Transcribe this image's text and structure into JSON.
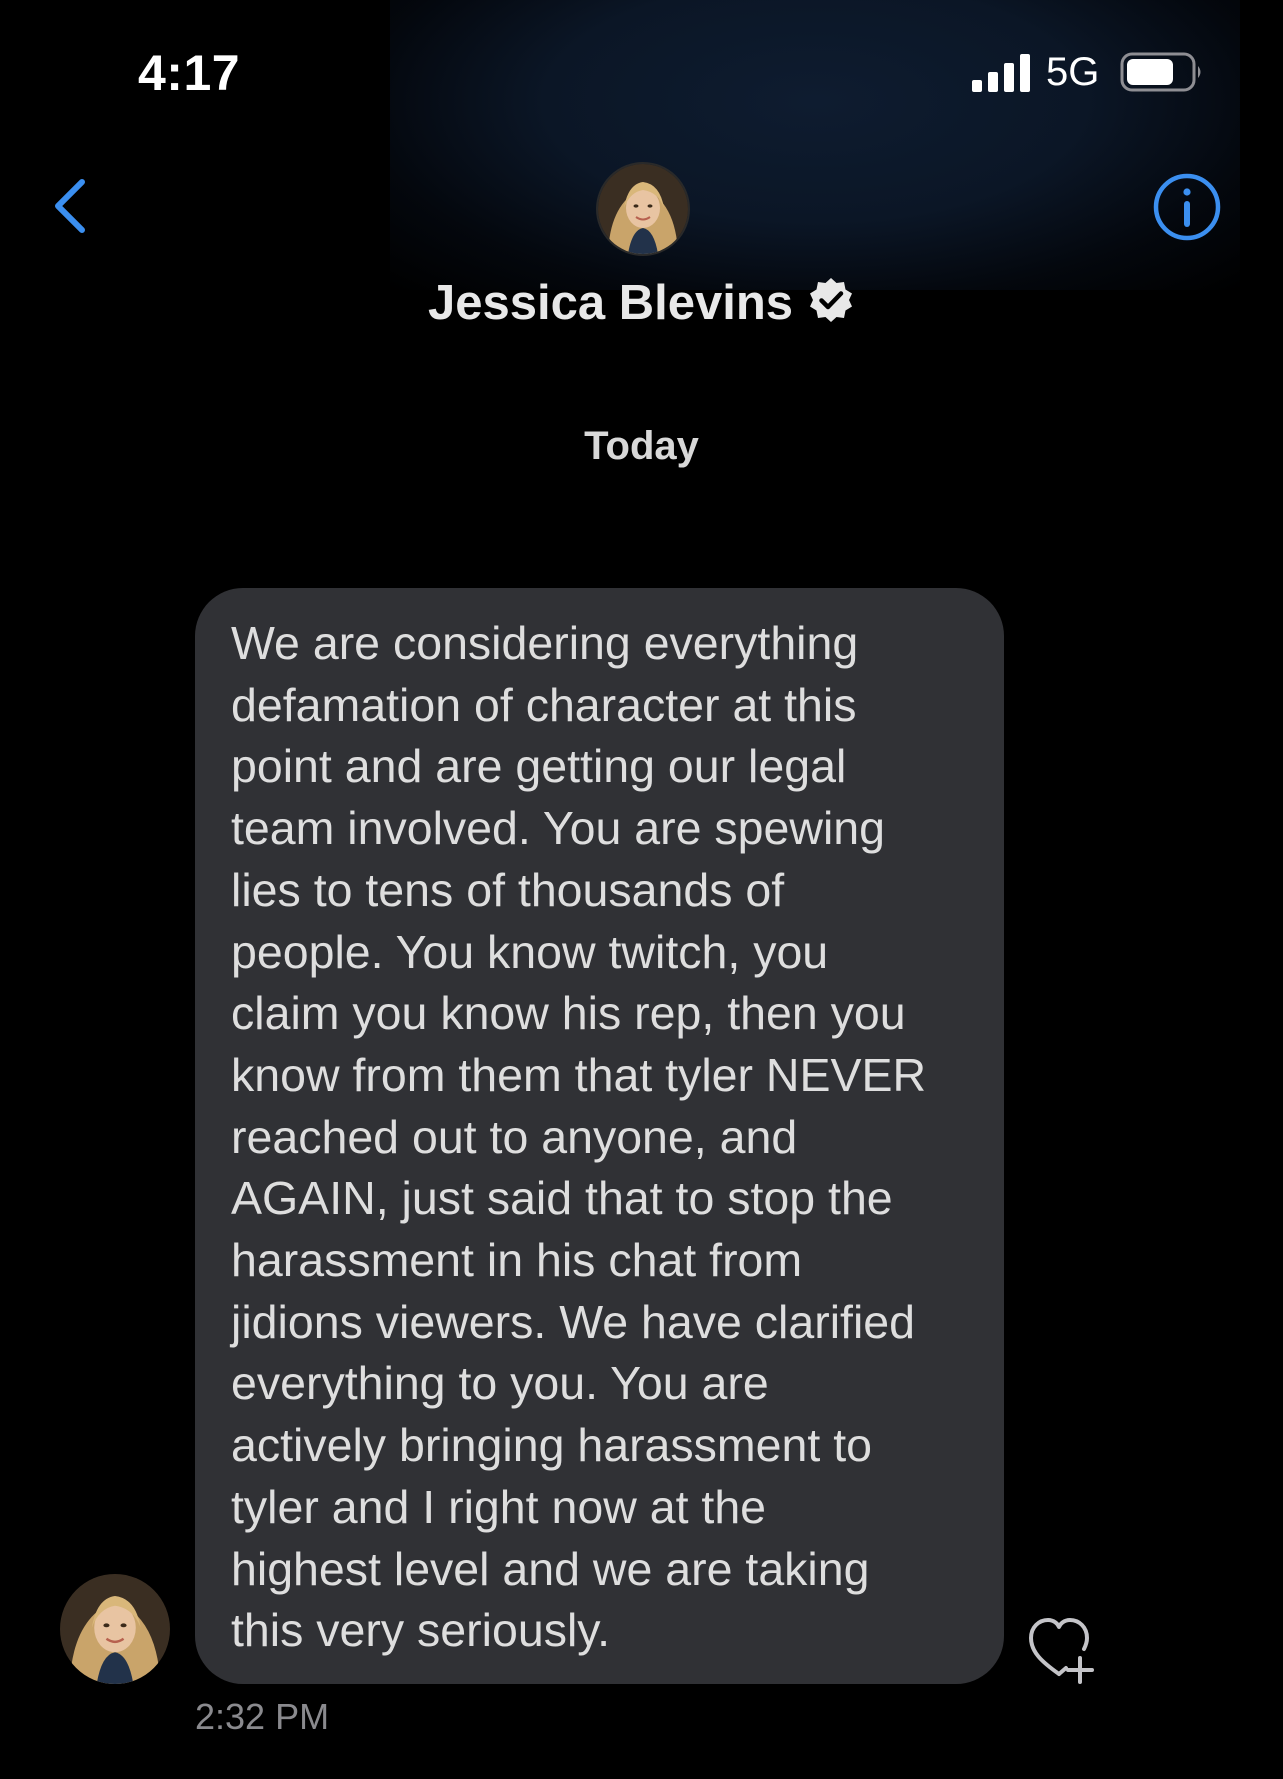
{
  "status_bar": {
    "time": "4:17",
    "network": "5G",
    "signal_icon": "cellular-signal-icon",
    "battery_icon": "battery-icon"
  },
  "header": {
    "back_icon": "chevron-left-icon",
    "info_icon": "info-circle-icon",
    "contact_name": "Jessica Blevins",
    "verified_icon": "verified-badge-icon",
    "accent_color": "#3b8ff0"
  },
  "conversation": {
    "date_divider": "Today",
    "messages": [
      {
        "text": "We are considering everything\ndefamation of character at this\npoint and are getting our legal\nteam involved. You are spewing\nlies to tens of thousands of\npeople. You know twitch, you\nclaim you know his rep, then you\nknow from them that tyler NEVER\nreached out to anyone, and\nAGAIN, just said that to stop the\nharassment in his chat from\njidions viewers. We have clarified\neverything to you. You are\nactively bringing harassment to\ntyler and I right now at the\nhighest level and we are taking\nthis very seriously.",
        "timestamp": "2:32 PM",
        "like_icon": "heart-plus-icon"
      }
    ]
  },
  "colors": {
    "background": "#000000",
    "bubble": "#303135",
    "timestamp": "#8a8a8e"
  }
}
